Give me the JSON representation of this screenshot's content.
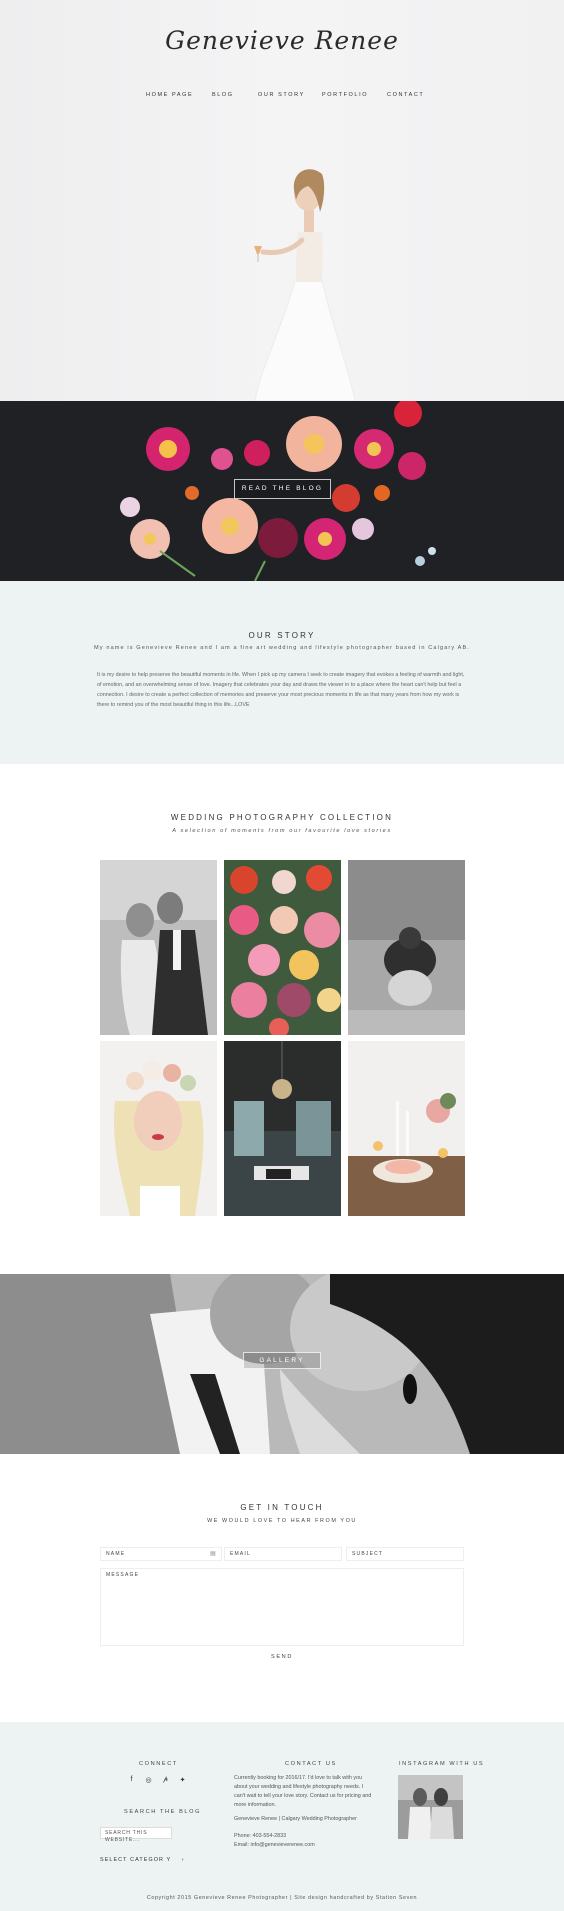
{
  "site": {
    "logo": "Genevieve Renee"
  },
  "nav": {
    "items": [
      "HOME PAGE",
      "BLOG",
      "OUR STORY",
      "PORTFOLIO",
      "CONTACT"
    ]
  },
  "blog_banner": {
    "button": "READ THE BLOG"
  },
  "story": {
    "title": "OUR STORY",
    "intro": "My name is Genevieve Renee and I am a fine art wedding and lifestyle photographer based in Calgary AB.",
    "body": "It is my desire to help preserve the beautiful moments in life. When I pick up my camera I seek to create imagery that evokes a feeling of warmth and light, of emotion, and an overwhelming sense of love. Imagery that celebrates your day and draws the viewer in to a place where the heart can't help but feel a connection. I desire to create a perfect collection of memories and preserve your most precious moments in life as that many years from how my work is there to remind you of the most beautiful thing in this life...LOVE"
  },
  "collection": {
    "title": "WEDDING PHOTOGRAPHY COLLECTION",
    "subtitle": "A selection of moments from our favourite love stories"
  },
  "kiss_banner": {
    "button": "GALLERY"
  },
  "contact": {
    "title": "GET IN TOUCH",
    "subtitle": "WE WOULD LOVE TO HEAR FROM YOU",
    "name_label": "NAME",
    "email_label": "EMAIL",
    "subject_label": "SUBJECT",
    "message_label": "MESSAGE",
    "send_label": "SEND"
  },
  "footer": {
    "connect_title": "CONNECT",
    "search_title": "SEARCH THE BLOG",
    "search_placeholder": "SEARCH THIS WEBSITE...",
    "select_category": "SELECT CATEGOR Y",
    "contact_title": "CONTACT US",
    "contact_text": "Currently booking for 2016/17. I'd love to talk with you about your wedding and lifestyle photography needs. I can't wait to tell your love story. Contact us for pricing and more information.",
    "business_line": "Genevieve Renee | Calgary Wedding Photographer",
    "phone": "Phone: 403-554-2833",
    "email": "Email: info@genevieverenee.com",
    "instagram_title": "INSTAGRAM WITH US",
    "copyright": "Copyright 2015 Genevieve Renee Photographer | Site design handcrafted by Station Seven"
  },
  "icons": {
    "social": [
      "facebook-icon",
      "instagram-icon",
      "pinterest-icon",
      "twitter-icon"
    ],
    "social_glyphs": [
      "f",
      "◎",
      "𝓅",
      "✦"
    ]
  },
  "colors": {
    "mint_background": "#edf3f2",
    "dark_banner": "#1f2125"
  }
}
